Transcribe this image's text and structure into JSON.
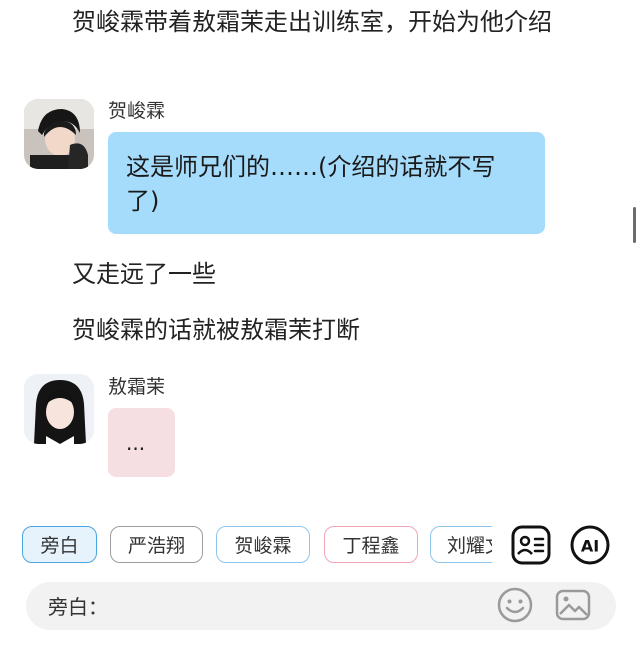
{
  "messages": {
    "narration_1": "贺峻霖带着敖霜茉走出训练室，开始为他介绍",
    "speaker_1": "贺峻霖",
    "bubble_1": "这是师兄们的……(介绍的话就不写了)",
    "narration_2": "又走远了一些",
    "narration_3": "贺峻霖的话就被敖霜茉打断",
    "speaker_2": "敖霜茉",
    "bubble_2": "..."
  },
  "role_chips": [
    {
      "label": "旁白",
      "state": "selected"
    },
    {
      "label": "严浩翔"
    },
    {
      "label": "贺峻霖"
    },
    {
      "label": "丁程鑫"
    },
    {
      "label": "刘耀文"
    }
  ],
  "toolbar": {
    "contacts_icon": "contact-card-icon",
    "ai_label": "AI"
  },
  "input": {
    "prefix": "旁白："
  },
  "colors": {
    "bubble_blue": "#a5dcfb",
    "bubble_pink": "#f6dfe2",
    "chip_blue": "#8fc7ec",
    "chip_pink": "#f2a5b7"
  }
}
